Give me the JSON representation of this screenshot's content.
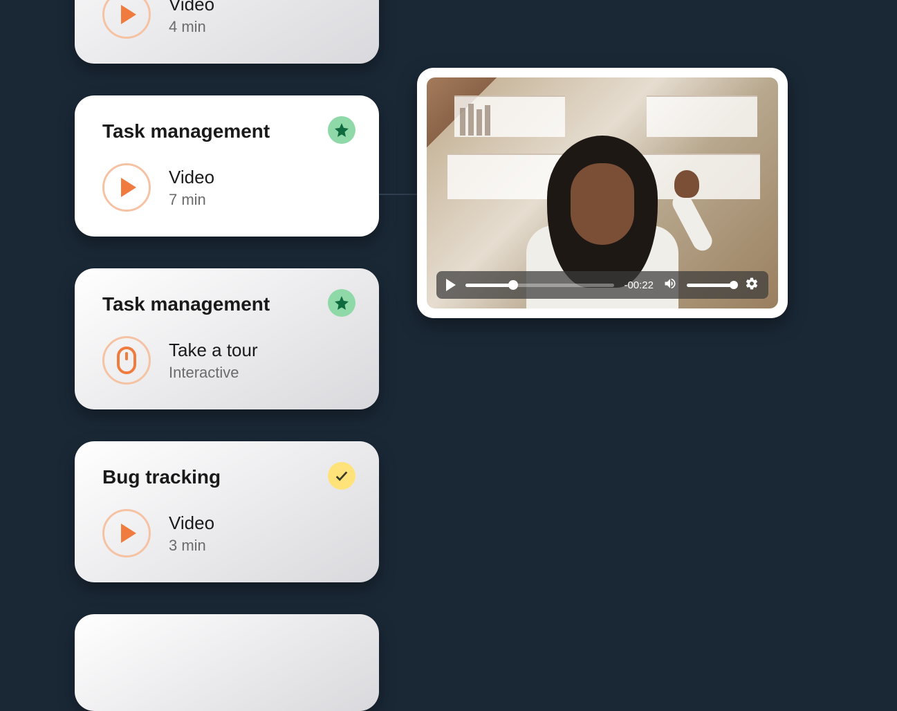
{
  "cards": [
    {
      "title": "",
      "type": "Video",
      "meta": "4 min",
      "icon": "play",
      "badge": null
    },
    {
      "title": "Task management",
      "type": "Video",
      "meta": "7 min",
      "icon": "play",
      "badge": "star",
      "active": true
    },
    {
      "title": "Task management",
      "type": "Take a tour",
      "meta": "Interactive",
      "icon": "mouse",
      "badge": "star"
    },
    {
      "title": "Bug tracking",
      "type": "Video",
      "meta": "3 min",
      "icon": "play",
      "badge": "check"
    },
    {
      "title": "",
      "type": "",
      "meta": "",
      "icon": "",
      "badge": null
    }
  ],
  "player": {
    "time_remaining": "-00:22",
    "progress_pct": 32,
    "volume_pct": 98
  },
  "colors": {
    "background": "#1a2836",
    "accent_orange": "#f07b3f",
    "badge_green": "#8fd9a8",
    "badge_yellow": "#ffe37a"
  }
}
